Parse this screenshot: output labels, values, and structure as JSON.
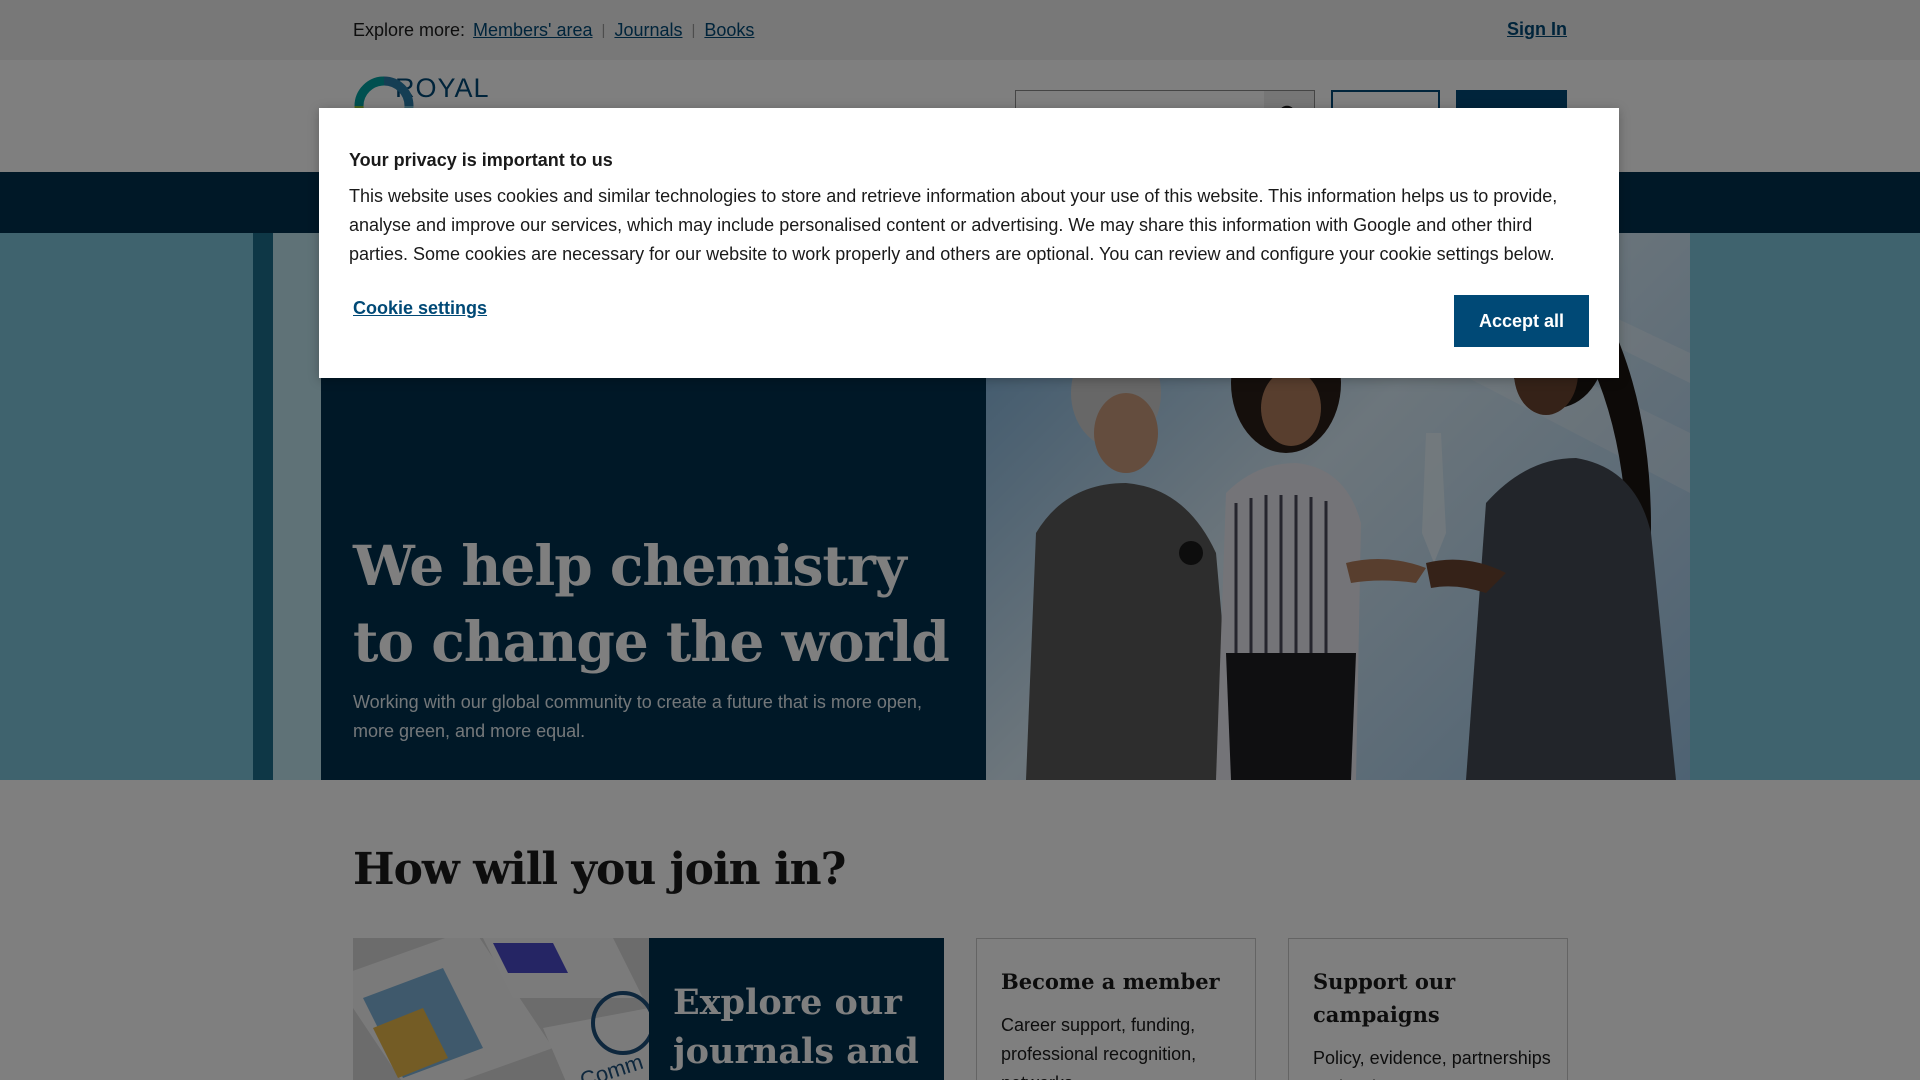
{
  "utility_bar": {
    "explore_label": "Explore more:",
    "links": [
      "Members' area",
      "Journals",
      "Books"
    ],
    "sign_in": "Sign In"
  },
  "header": {
    "logo_text": "ROYAL SOCIETY"
  },
  "hero": {
    "title": "We help chemistry to change the world",
    "subtitle": "Working with our global community to create a future that is more open, more green, and more equal."
  },
  "join": {
    "title": "How will you join in?",
    "journals_card": {
      "title": "Explore our journals and"
    },
    "member_card": {
      "title": "Become a member",
      "body": "Career support, funding, professional recognition, networks."
    },
    "campaign_card": {
      "title": "Support our campaigns",
      "body": "Policy, evidence, partnerships and action to"
    }
  },
  "cookie_modal": {
    "title": "Your privacy is important to us",
    "body": "This website uses cookies and similar technologies to store and retrieve information about your use of this website. This information helps us to provide, analyse and improve our services, which may include personalised content or advertising. We may share this information with Google and other third parties. Some cookies are necessary for our website to work properly and others are optional. You can review and configure your cookie settings below.",
    "settings_link": "Cookie settings",
    "accept_button": "Accept all"
  },
  "colors": {
    "brand_navy": "#00304f",
    "brand_blue": "#004976",
    "hero_teal": "#7fc7dc"
  }
}
